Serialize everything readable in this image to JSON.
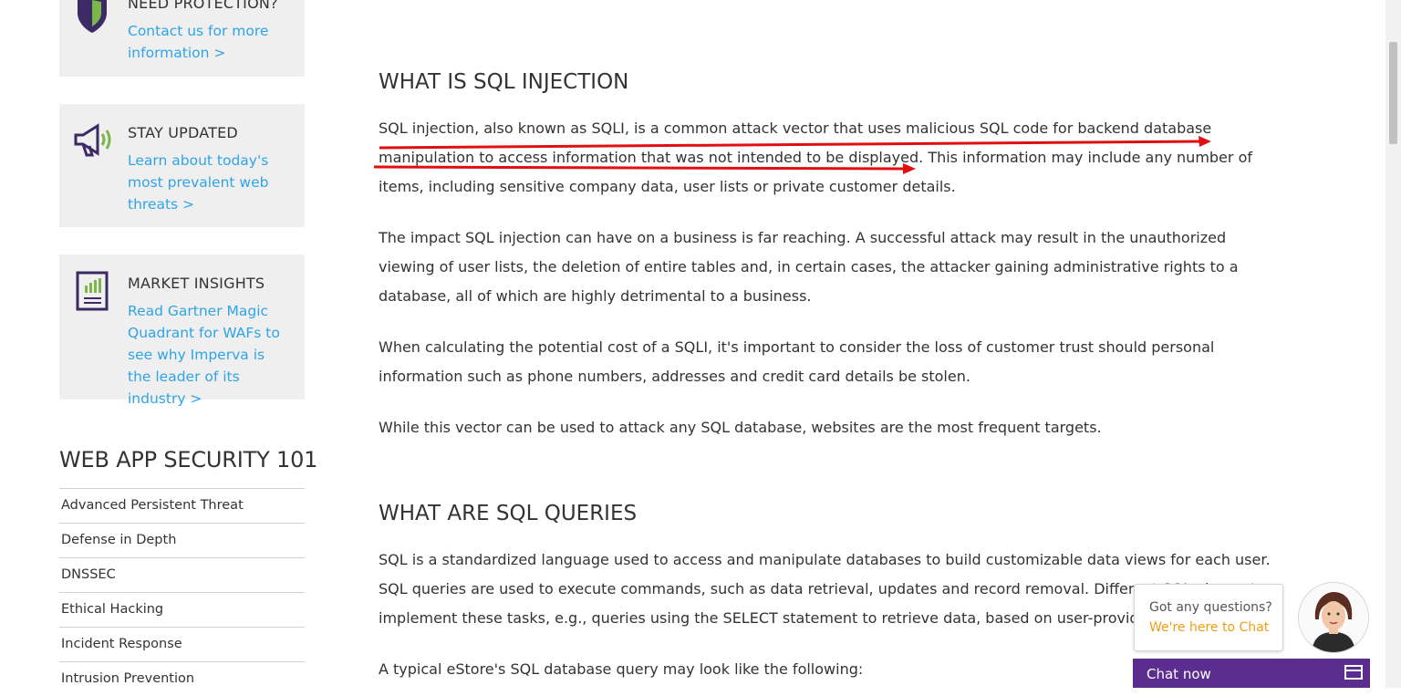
{
  "sidebar": {
    "protection": {
      "title": "NEED PROTECTION?",
      "link": "Contact us for more information >"
    },
    "updated": {
      "title": "STAY UPDATED",
      "link": "Learn about today's most prevalent web threats >"
    },
    "insights": {
      "title": "MARKET INSIGHTS",
      "link": "Read Gartner Magic Quadrant for WAFs to see why Imperva is the leader of its industry >"
    },
    "security_title": "WEB APP SECURITY 101",
    "security_items": [
      "Advanced Persistent Threat",
      "Defense in Depth",
      "DNSSEC",
      "Ethical Hacking",
      "Incident Response",
      "Intrusion Prevention"
    ]
  },
  "main": {
    "h_what_is": "WHAT IS SQL INJECTION",
    "p1": "SQL injection, also known as SQLI, is a common attack vector that uses malicious SQL code for backend database manipulation to access information that was not intended to be displayed. This information may include any number of items, including sensitive company data, user lists or private customer details.",
    "p2": "The impact SQL injection can have on a business is far reaching. A successful attack may result in the unauthorized viewing of user lists, the deletion of entire tables and, in certain cases, the attacker gaining administrative rights to a database, all of which are highly detrimental to a business.",
    "p3": "When calculating the potential cost of a SQLI, it's important to consider the loss of customer trust should personal information such as phone numbers, addresses and credit card details be stolen.",
    "p4": "While this vector can be used to attack any SQL database, websites are the most frequent targets.",
    "h_queries": "WHAT ARE SQL QUERIES",
    "p5": "SQL is a standardized language used to access and manipulate databases to build customizable data views for each user. SQL queries are used to execute commands, such as data retrieval, updates and record removal. Different SQL elements implement these tasks, e.g., queries using the SELECT statement to retrieve data, based on user-provided parameters.",
    "p6": "A typical eStore's SQL database query may look like the following:"
  },
  "chat": {
    "question": "Got any questions?",
    "answer": "We're here to Chat",
    "button": "Chat now"
  },
  "colors": {
    "link": "#2fa4e7",
    "chat_accent": "#f39c12",
    "chat_bar": "#5b2d8e",
    "annotation": "#e01010"
  }
}
